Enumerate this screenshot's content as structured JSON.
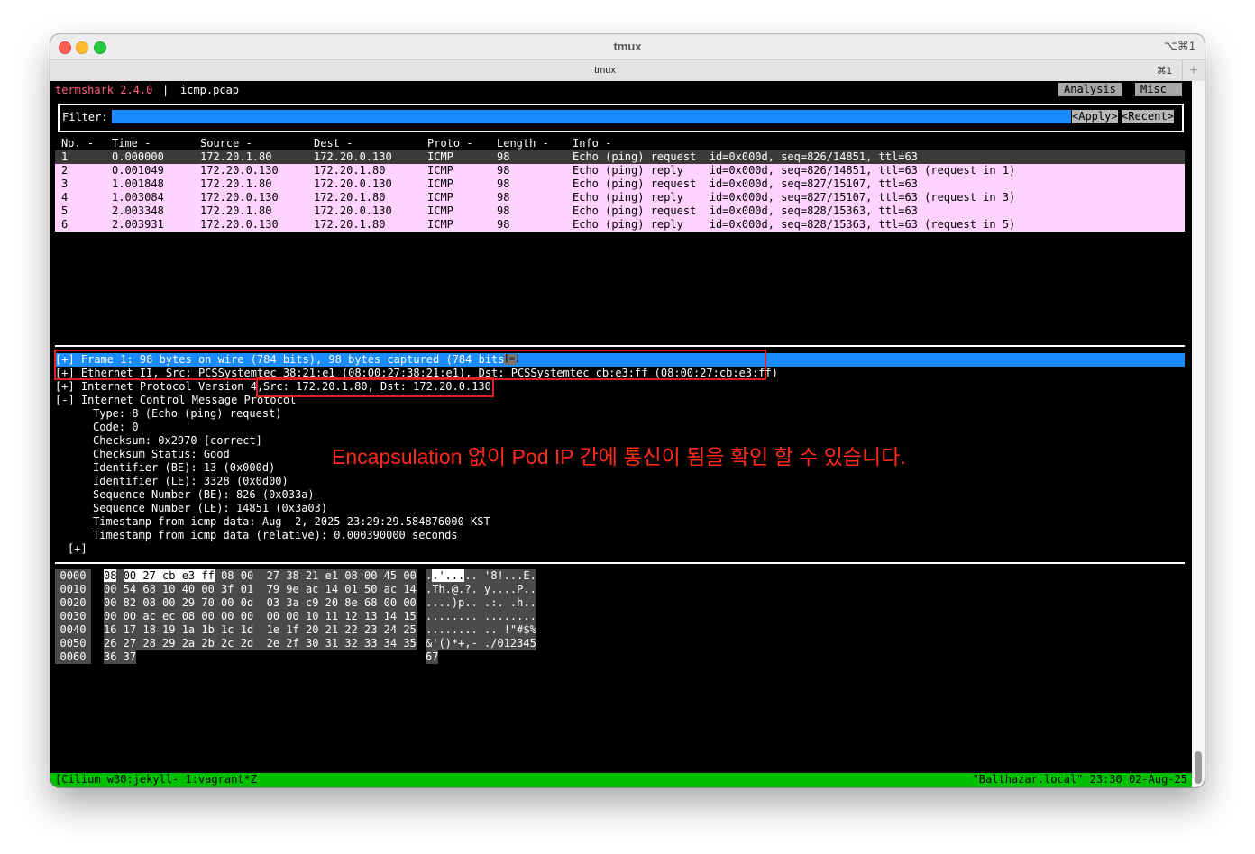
{
  "window": {
    "title": "tmux",
    "shortcut": "⌥⌘1",
    "tab_title": "tmux",
    "tab_shortcut": "⌘1",
    "tab_add": "+"
  },
  "header": {
    "app": "termshark 2.4.0",
    "separator": "|",
    "file": "icmp.pcap",
    "menu": [
      "Analysis",
      "Misc"
    ]
  },
  "filter": {
    "label": "Filter:",
    "value": "",
    "apply": "<Apply>",
    "recent": "<Recent>"
  },
  "packet_list": {
    "columns": [
      "No. -",
      "Time -",
      "Source -",
      "Dest -",
      "Proto -",
      "Length -",
      "Info -"
    ],
    "rows": [
      {
        "no": "1",
        "time": "0.000000",
        "src": "172.20.1.80",
        "dst": "172.20.0.130",
        "proto": "ICMP",
        "len": "98",
        "info": "Echo (ping) request  id=0x000d, seq=826/14851, ttl=63"
      },
      {
        "no": "2",
        "time": "0.001049",
        "src": "172.20.0.130",
        "dst": "172.20.1.80",
        "proto": "ICMP",
        "len": "98",
        "info": "Echo (ping) reply    id=0x000d, seq=826/14851, ttl=63 (request in 1)"
      },
      {
        "no": "3",
        "time": "1.001848",
        "src": "172.20.1.80",
        "dst": "172.20.0.130",
        "proto": "ICMP",
        "len": "98",
        "info": "Echo (ping) request  id=0x000d, seq=827/15107, ttl=63"
      },
      {
        "no": "4",
        "time": "1.003084",
        "src": "172.20.0.130",
        "dst": "172.20.1.80",
        "proto": "ICMP",
        "len": "98",
        "info": "Echo (ping) reply    id=0x000d, seq=827/15107, ttl=63 (request in 3)"
      },
      {
        "no": "5",
        "time": "2.003348",
        "src": "172.20.1.80",
        "dst": "172.20.0.130",
        "proto": "ICMP",
        "len": "98",
        "info": "Echo (ping) request  id=0x000d, seq=828/15363, ttl=63"
      },
      {
        "no": "6",
        "time": "2.003931",
        "src": "172.20.0.130",
        "dst": "172.20.1.80",
        "proto": "ICMP",
        "len": "98",
        "info": "Echo (ping) reply    id=0x000d, seq=828/15363, ttl=63 (request in 5)"
      }
    ]
  },
  "details": {
    "frame": "[+] Frame 1: 98 bytes on wire (784 bits), 98 bytes captured (784 bits)",
    "frame_mark": "[=]",
    "ethernet": "[+] Ethernet II, Src: PCSSystemtec_38:21:e1 (08:00:27:38:21:e1), Dst: PCSSystemtec_cb:e3:ff (08:00:27:cb:e3:ff)",
    "ip_prefix": "[+] Internet Protocol Version 4, ",
    "ip_src_dst": "Src: 172.20.1.80, Dst: 172.20.0.130",
    "icmp": "[-] Internet Control Message Protocol",
    "fields": [
      "Type: 8 (Echo (ping) request)",
      "Code: 0",
      "Checksum: 0x2970 [correct]",
      "Checksum Status: Good",
      "Identifier (BE): 13 (0x000d)",
      "Identifier (LE): 3328 (0x0d00)",
      "Sequence Number (BE): 826 (0x033a)",
      "Sequence Number (LE): 14851 (0x3a03)",
      "Timestamp from icmp data: Aug  2, 2025 23:29:29.584876000 KST",
      "Timestamp from icmp data (relative): 0.000390000 seconds"
    ],
    "data_node": "[+]"
  },
  "annotation": "Encapsulation 없이 Pod IP 간에 통신이 됨을 확인 할 수 있습니다.",
  "hex": {
    "first_byte": "08",
    "first_rest": "00 27 cb e3 ff",
    "first_tail": " 08 00  27 38 21 e1 08 00 45 00",
    "first_ascii_a": ".",
    "first_ascii_b": ".'...",
    "first_ascii_c": ".. '8!...E.",
    "lines": [
      {
        "offset": "0010",
        "bytes": "00 54 68 10 40 00 3f 01  79 9e ac 14 01 50 ac 14",
        "ascii": ".Th.@.?. y....P.."
      },
      {
        "offset": "0020",
        "bytes": "00 82 08 00 29 70 00 0d  03 3a c9 20 8e 68 00 00",
        "ascii": "....)p.. .:. .h.."
      },
      {
        "offset": "0030",
        "bytes": "00 00 ac ec 08 00 00 00  00 00 10 11 12 13 14 15",
        "ascii": "........ ........"
      },
      {
        "offset": "0040",
        "bytes": "16 17 18 19 1a 1b 1c 1d  1e 1f 20 21 22 23 24 25",
        "ascii": "........ .. !\"#$%"
      },
      {
        "offset": "0050",
        "bytes": "26 27 28 29 2a 2b 2c 2d  2e 2f 30 31 32 33 34 35",
        "ascii": "&'()*+,- ./012345"
      },
      {
        "offset": "0060",
        "bytes": "36 37",
        "ascii": "67"
      }
    ],
    "first_offset": "0000"
  },
  "status": {
    "left": "[Cilium w30:jekyll- 1:vagrant*Z",
    "right": "\"Balthazar.local\" 23:30 02-Aug-25"
  },
  "colors": {
    "accent_blue": "#1a8cff",
    "row_pink": "#ffd2ff",
    "status_green": "#00c000",
    "annotation_red": "#e0201b",
    "app_name": "#ff5f7f"
  }
}
